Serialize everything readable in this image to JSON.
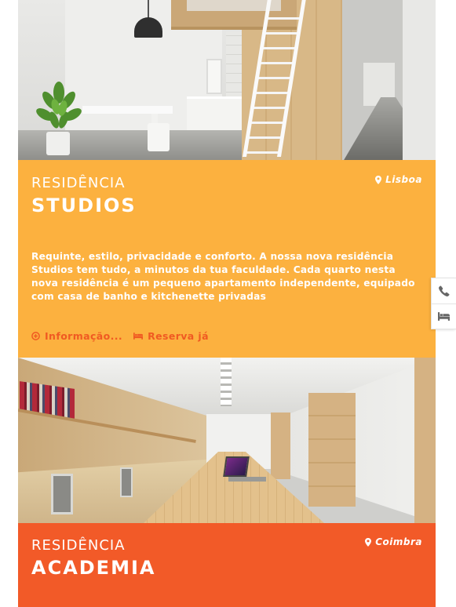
{
  "residences": [
    {
      "kicker": "RESIDÊNCIA",
      "name": "STUDIOS",
      "city": "Lisboa",
      "description": "Requinte, estilo, privacidade e conforto. A nossa nova residência Studios tem tudo, a minutos da tua faculdade. Cada quarto nesta nova residência é um pequeno apartamento independente, equipado com casa de banho e kitchenette privadas",
      "info_label": "Informação...",
      "book_label": "Reserva já",
      "panel_color": "#fcb13f",
      "link_color": "#f05a22",
      "image_icon": "loft-studio-photo"
    },
    {
      "kicker": "RESIDÊNCIA",
      "name": "ACADEMIA",
      "city": "Coimbra",
      "panel_color": "#f25a28",
      "image_icon": "kitchen-photo"
    }
  ],
  "side_buttons": [
    {
      "icon": "phone-icon"
    },
    {
      "icon": "bed-icon"
    }
  ]
}
